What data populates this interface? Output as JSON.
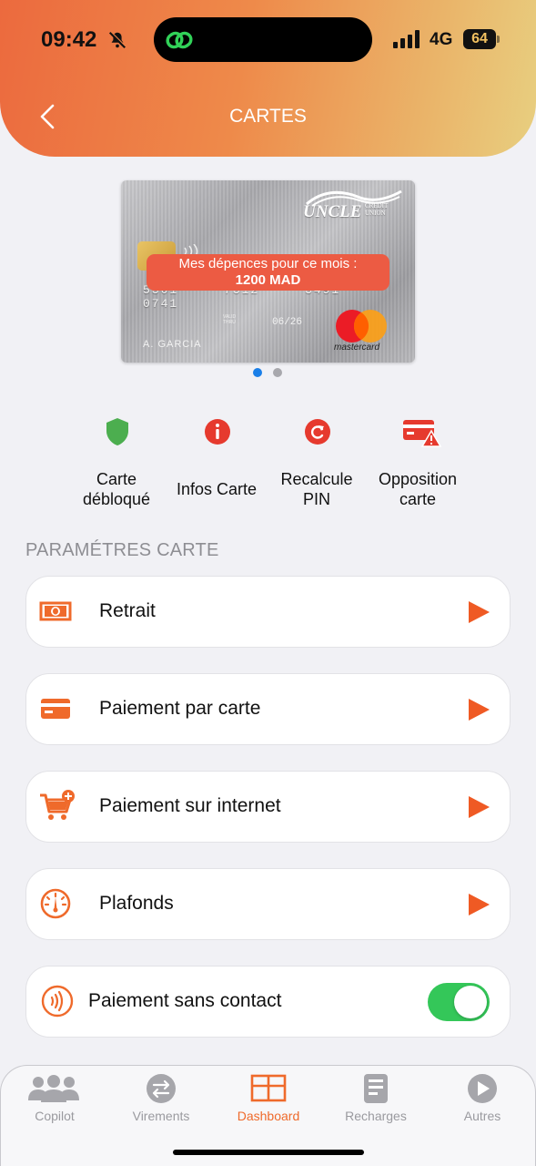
{
  "status_bar": {
    "time": "09:42",
    "network": "4G",
    "battery": "64"
  },
  "header": {
    "title": "CARTES"
  },
  "card": {
    "brand": "UNCLE",
    "brand_small": "CREDIT UNION",
    "number": "5301 7312 3491 0741",
    "valid_thru": "VALID THRU",
    "expiry": "06/26",
    "holder": "A. GARCIA",
    "network": "mastercard",
    "spending_label": "Mes dépences pour ce mois :",
    "spending_value": "1200 MAD",
    "pager": {
      "count": 2,
      "active": 0
    }
  },
  "actions": [
    {
      "label": "Carte\ndébloqué",
      "icon": "shield-icon",
      "color": "#4cae4f"
    },
    {
      "label": "Infos Carte",
      "icon": "info-icon",
      "color": "#e63a2e"
    },
    {
      "label": "Recalcule\nPIN",
      "icon": "refresh-icon",
      "color": "#e63a2e"
    },
    {
      "label": "Opposition\ncarte",
      "icon": "card-warning-icon",
      "color": "#e63a2e"
    }
  ],
  "section": {
    "title": "PARAMÉTRES CARTE"
  },
  "settings": [
    {
      "label": "Retrait",
      "icon": "cash-icon"
    },
    {
      "label": "Paiement par carte",
      "icon": "credit-card-icon"
    },
    {
      "label": "Paiement sur internet",
      "icon": "cart-add-icon"
    },
    {
      "label": "Plafonds",
      "icon": "gauge-icon"
    }
  ],
  "contactless": {
    "label": "Paiement sans contact",
    "enabled": true,
    "icon": "contactless-icon"
  },
  "tabs": [
    {
      "label": "Copilot",
      "icon": "users-icon",
      "active": false
    },
    {
      "label": "Virements",
      "icon": "transfer-icon",
      "active": false
    },
    {
      "label": "Dashboard",
      "icon": "dashboard-icon",
      "active": true
    },
    {
      "label": "Recharges",
      "icon": "document-icon",
      "active": false
    },
    {
      "label": "Autres",
      "icon": "play-icon",
      "active": false
    }
  ],
  "colors": {
    "accent": "#ef6a2b",
    "toggle_on": "#34c759",
    "banner": "#ec5b43",
    "dot_active": "#1a7fe8",
    "dot_inactive": "#a8a8ad"
  }
}
